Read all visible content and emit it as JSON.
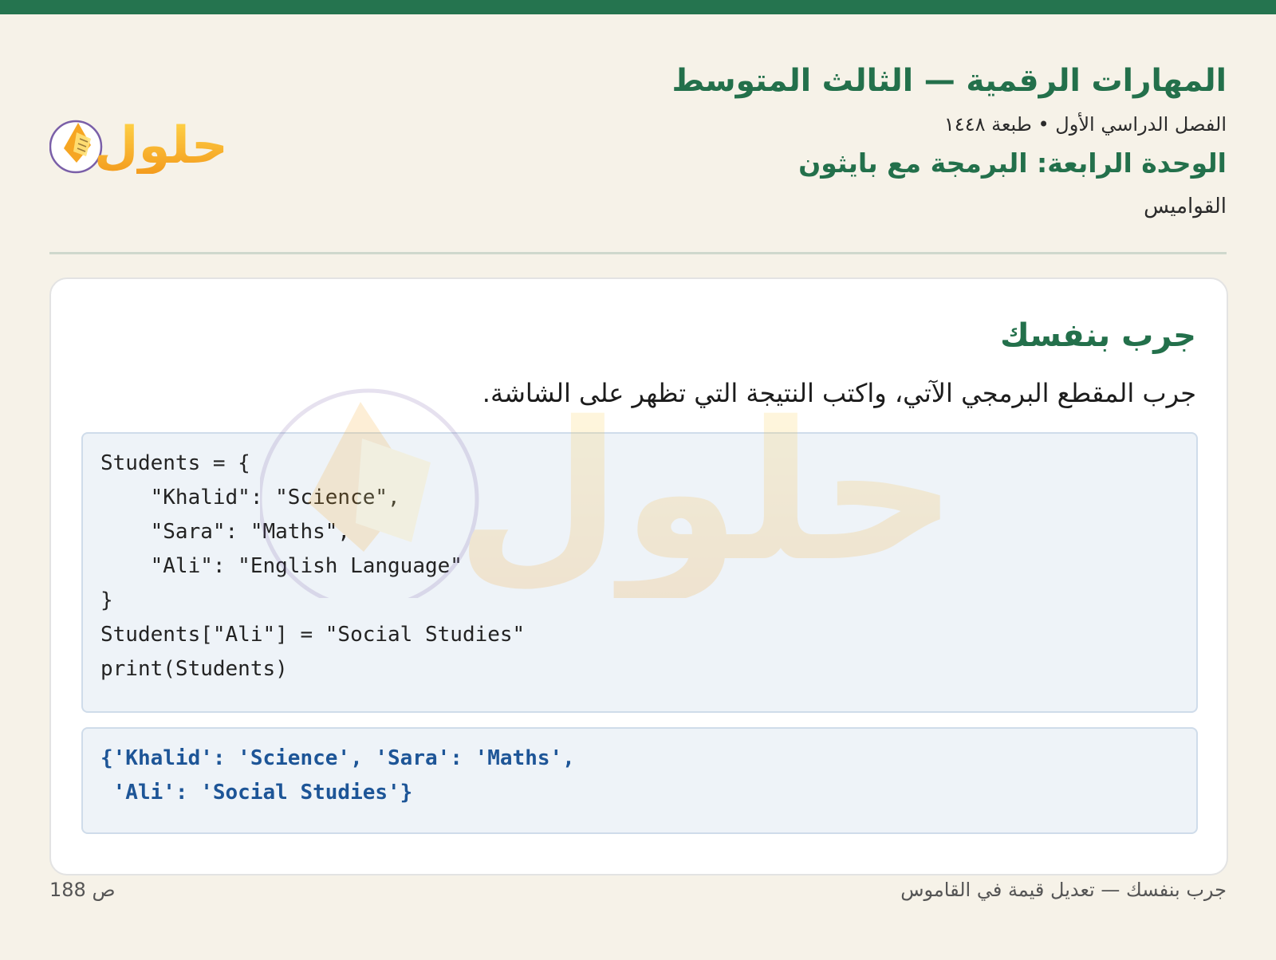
{
  "header": {
    "book_title": "المهارات الرقمية — الثالث المتوسط",
    "semester": "الفصل الدراسي الأول • طبعة ١٤٤٨",
    "unit_title": "الوحدة الرابعة: البرمجة مع بايثون",
    "lesson_title": "القواميس",
    "logo_text": "حلول",
    "logo_icon": "book-pencil-icon"
  },
  "card": {
    "title": "جرب بنفسك",
    "instruction": "جرب المقطع البرمجي الآتي، واكتب النتيجة التي تظهر على الشاشة.",
    "code_lines": [
      "Students = {",
      "    \"Khalid\": \"Science\",",
      "    \"Sara\": \"Maths\",",
      "    \"Ali\": \"English Language\"",
      "}",
      "Students[\"Ali\"] = \"Social Studies\"",
      "print(Students)"
    ],
    "output_lines": [
      "{'Khalid': 'Science', 'Sara': 'Maths',",
      " 'Ali': 'Social Studies'}"
    ]
  },
  "footer": {
    "caption": "جرب بنفسك — تعديل قيمة في القاموس",
    "page": "ص 188"
  },
  "colors": {
    "accent": "#25744f",
    "code_bg": "#eef3f8",
    "output_text": "#1d5597",
    "page_bg": "#f6f2e8"
  }
}
